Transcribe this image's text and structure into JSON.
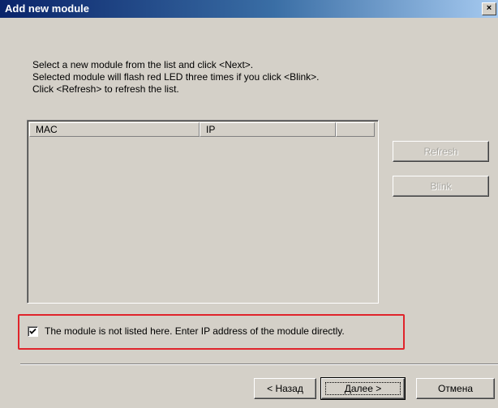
{
  "window": {
    "title": "Add new module",
    "close_label": "×"
  },
  "instructions": [
    "Select a new module from the list and click <Next>.",
    "Selected module will flash red LED three times if you click <Blink>.",
    "Click <Refresh> to refresh the list."
  ],
  "module_list": {
    "columns": [
      "MAC",
      "IP",
      ""
    ],
    "rows": []
  },
  "side_buttons": {
    "refresh_label": "Refresh",
    "blink_label": "Blink",
    "enabled": false
  },
  "manual_entry": {
    "checked": true,
    "label": "The module is not listed here. Enter IP address of the module directly."
  },
  "footer": {
    "back_label": "< Назад",
    "next_label": "Далее >",
    "cancel_label": "Отмена"
  },
  "colors": {
    "highlight": "#e0242b",
    "dialog_bg": "#d4d0c8",
    "title_bar": "#0a246a"
  }
}
